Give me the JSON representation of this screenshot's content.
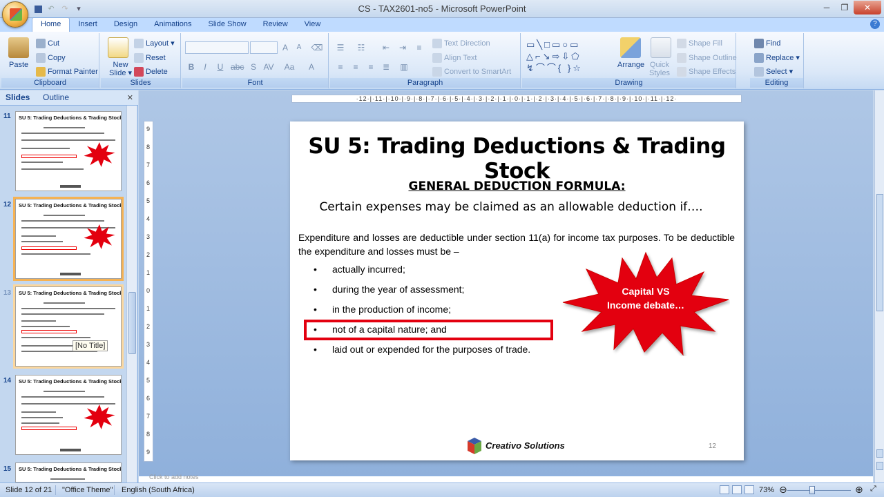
{
  "window": {
    "title": "CS - TAX2601-no5 - Microsoft PowerPoint",
    "controls": [
      "minimize",
      "restore",
      "close"
    ]
  },
  "ribbon_tabs": [
    "Home",
    "Insert",
    "Design",
    "Animations",
    "Slide Show",
    "Review",
    "View"
  ],
  "active_tab": "Home",
  "ribbon": {
    "clipboard": {
      "label": "Clipboard",
      "paste": "Paste",
      "cut": "Cut",
      "copy": "Copy",
      "format_painter": "Format Painter"
    },
    "slides": {
      "label": "Slides",
      "new_slide_1": "New",
      "new_slide_2": "Slide",
      "layout": "Layout",
      "reset": "Reset",
      "delete": "Delete"
    },
    "font": {
      "label": "Font"
    },
    "paragraph": {
      "label": "Paragraph",
      "text_direction": "Text Direction",
      "align_text": "Align Text",
      "convert_smartart": "Convert to SmartArt"
    },
    "drawing": {
      "label": "Drawing",
      "arrange": "Arrange",
      "quick_styles_1": "Quick",
      "quick_styles_2": "Styles",
      "shape_fill": "Shape Fill",
      "shape_outline": "Shape Outline",
      "shape_effects": "Shape Effects"
    },
    "editing": {
      "label": "Editing",
      "find": "Find",
      "replace": "Replace",
      "select": "Select"
    }
  },
  "slides_pane": {
    "tabs": [
      "Slides",
      "Outline"
    ],
    "active_tab": "Slides",
    "thumbnails": [
      {
        "number": "11",
        "title": "SU 5: Trading Deductions & Trading Stock",
        "selected": false
      },
      {
        "number": "12",
        "title": "SU 5: Trading Deductions & Trading Stock",
        "selected": true
      },
      {
        "number": "13",
        "title": "SU 5: Trading Deductions & Trading Stock",
        "selected": false
      },
      {
        "number": "14",
        "title": "SU 5: Trading Deductions & Trading Stock",
        "selected": false
      },
      {
        "number": "15",
        "title": "SU 5: Trading Deductions & Trading Stock",
        "selected": false
      }
    ],
    "tooltip": "[No Title]"
  },
  "ruler": {
    "horizontal": "·12·|·11·|·10·|·9·|·8·|·7·|·6·|·5·|·4·|·3·|·2·|·1·|·0·|·1·|·2·|·3·|·4·|·5·|·6·|·7·|·8·|·9·|·10·|·11·|·12·",
    "vertical": [
      "9",
      "8",
      "7",
      "6",
      "5",
      "4",
      "3",
      "2",
      "1",
      "0",
      "1",
      "2",
      "3",
      "4",
      "5",
      "6",
      "7",
      "8",
      "9"
    ]
  },
  "slide": {
    "title": "SU 5: Trading Deductions & Trading Stock",
    "heading": "GENERAL DEDUCTION FORMULA:",
    "subheading": "Certain expenses may be claimed as an allowable  deduction if….",
    "paragraph": "Expenditure and losses are deductible under section 11(a) for income tax purposes. To be deductible the expenditure and losses must be –",
    "bullets": [
      "actually incurred;",
      "during the year of assessment;",
      "in the production of income;",
      "not of a capital nature; and",
      "laid out or expended for the purposes of trade."
    ],
    "highlighted_bullet": "not of a capital nature; and",
    "callout_line1": "Capital VS",
    "callout_line2": "Income debate…",
    "brand": "Creativo Solutions",
    "slide_number": "12"
  },
  "notes_placeholder": "Click to add notes",
  "status": {
    "slide_info": "Slide 12 of 21",
    "theme": "\"Office Theme\"",
    "language": "English (South Africa)",
    "zoom": "73%"
  },
  "colors": {
    "accent_red": "#e3000f",
    "ribbon_blue": "#15428b",
    "selected_thumb": "#f6b253"
  }
}
